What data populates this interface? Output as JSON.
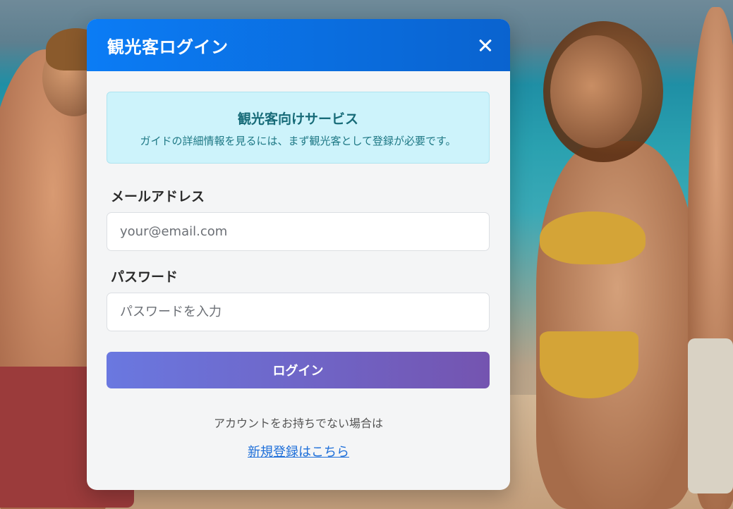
{
  "modal": {
    "title": "観光客ログイン",
    "close_icon": "close-icon"
  },
  "info": {
    "title": "観光客向けサービス",
    "text": "ガイドの詳細情報を見るには、まず観光客として登録が必要です。"
  },
  "form": {
    "email_label": "メールアドレス",
    "email_placeholder": "your@email.com",
    "email_value": "",
    "password_label": "パスワード",
    "password_placeholder": "パスワードを入力",
    "password_value": "",
    "login_button": "ログイン"
  },
  "footer": {
    "no_account_text": "アカウントをお持ちでない場合は",
    "register_link": "新規登録はこちら"
  },
  "colors": {
    "header_start": "#0b7cf5",
    "header_end": "#0a63cf",
    "button_start": "#6a78e0",
    "button_end": "#7454b0",
    "info_bg": "#cdf3fb",
    "link": "#1e6fd9"
  }
}
